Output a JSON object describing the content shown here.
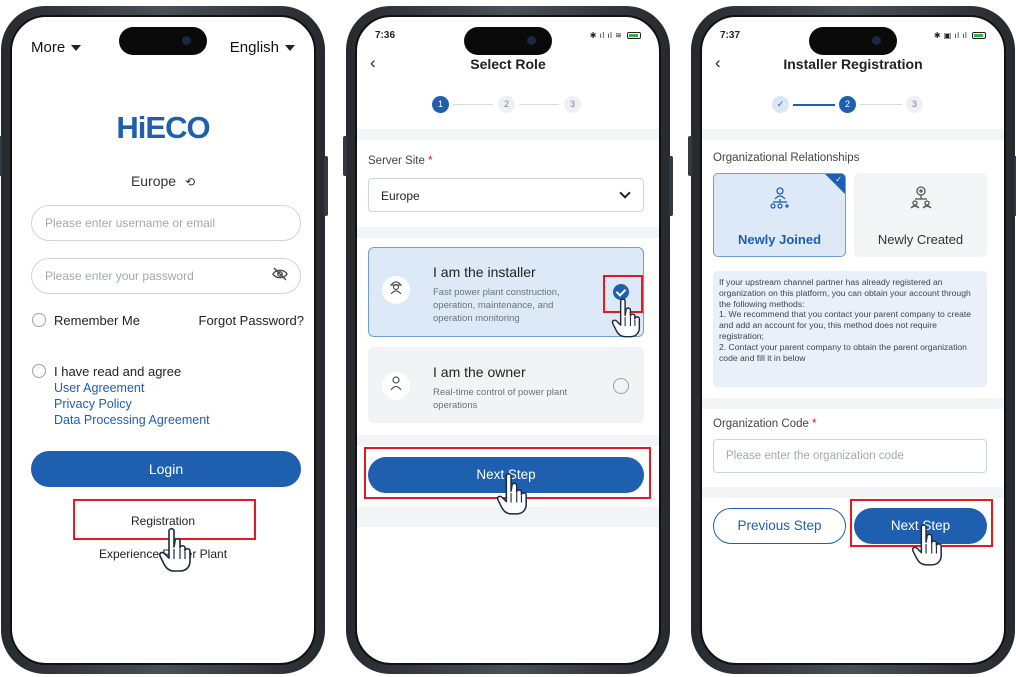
{
  "phones": [
    {
      "more_label": "More",
      "language_label": "English",
      "logo_text": "HiECO",
      "region": "Europe",
      "region_icon": "refresh-icon",
      "username_placeholder": "Please enter username or email",
      "password_placeholder": "Please enter your password",
      "remember_label": "Remember Me",
      "forgot_label": "Forgot Password?",
      "agree_label": "I have read and agree",
      "links": [
        "User Agreement",
        "Privacy Policy",
        "Data Processing Agreement"
      ],
      "login_label": "Login",
      "registration_label": "Registration",
      "experience_label": "Experience Power Plant"
    },
    {
      "time": "7:36",
      "title": "Select Role",
      "steps": [
        "1",
        "2",
        "3"
      ],
      "server_site_label": "Server Site",
      "required_mark": "*",
      "server_site_value": "Europe",
      "roles": [
        {
          "title": "I am the installer",
          "desc": "Fast power plant construction, operation, maintenance, and operation monitoring",
          "selected": true,
          "icon": "worker-icon"
        },
        {
          "title": "I am the owner",
          "desc": "Real-time control of power plant operations",
          "selected": false,
          "icon": "person-icon"
        }
      ],
      "next_label": "Next Step"
    },
    {
      "time": "7:37",
      "title": "Installer Registration",
      "steps": [
        "✓",
        "2",
        "3"
      ],
      "org_rel_label": "Organizational Relationships",
      "org_options": [
        {
          "label": "Newly Joined",
          "selected": true,
          "icon": "org-join-icon"
        },
        {
          "label": "Newly Created",
          "selected": false,
          "icon": "org-create-icon"
        }
      ],
      "note_lines": [
        "If your upstream channel partner has already registered an organization on this platform, you can obtain your account through the following methods:",
        "1. We recommend that you contact your parent company to create and add an account for you, this method does not require registration;",
        "2. Contact your parent company to obtain the parent organization code and fill it in below"
      ],
      "org_code_label": "Organization Code",
      "required_mark": "*",
      "org_code_placeholder": "Please enter the organization code",
      "prev_label": "Previous Step",
      "next_label": "Next Step"
    }
  ],
  "colors": {
    "primary": "#1e5faf",
    "highlight": "#e21b23",
    "selected_bg": "#dde9f7"
  }
}
